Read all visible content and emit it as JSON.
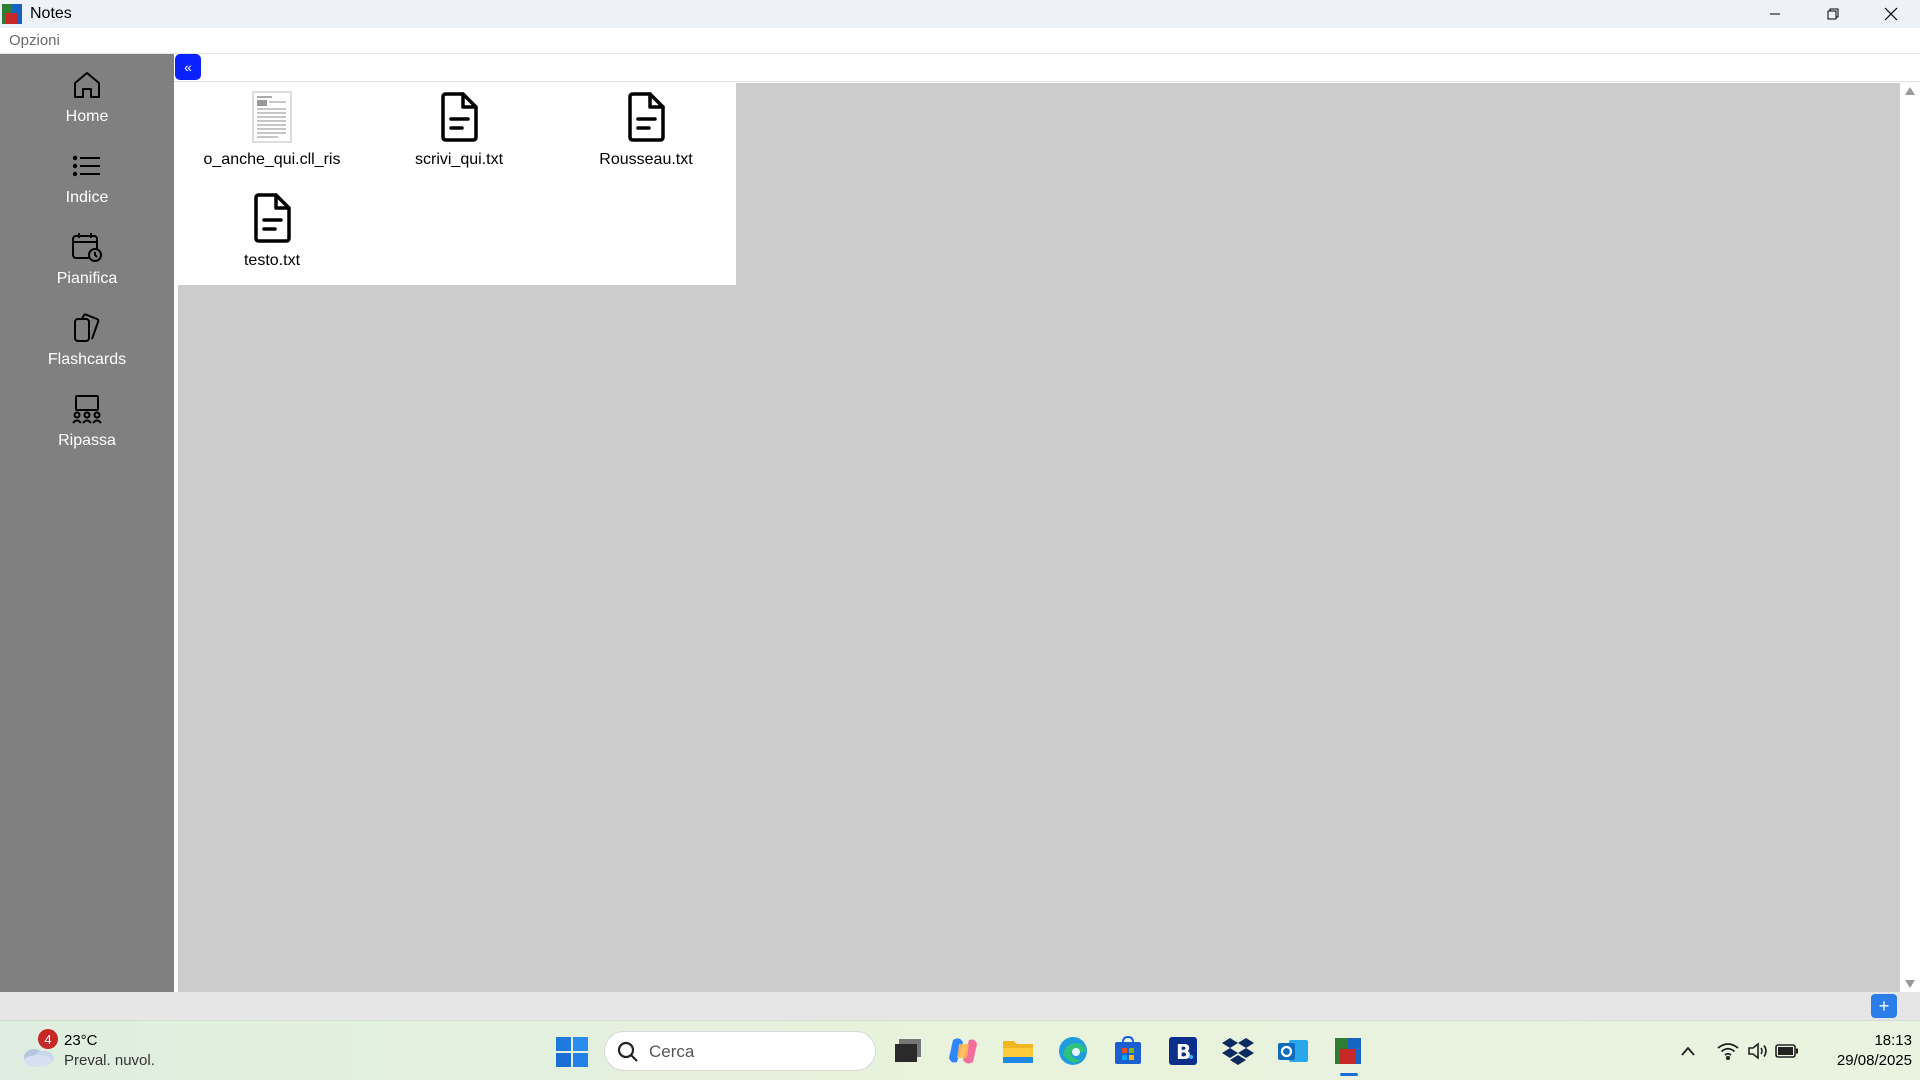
{
  "window": {
    "title": "Notes"
  },
  "menu": {
    "options_label": "Opzioni"
  },
  "sidebar": {
    "items": [
      {
        "label": "Home",
        "icon": "home-icon"
      },
      {
        "label": "Indice",
        "icon": "list-icon"
      },
      {
        "label": "Pianifica",
        "icon": "calendar-clock-icon"
      },
      {
        "label": "Flashcards",
        "icon": "flashcards-icon"
      },
      {
        "label": "Ripassa",
        "icon": "review-icon"
      }
    ]
  },
  "main": {
    "collapse_label": "«",
    "files": [
      {
        "name": "o_anche_qui.cll_ris",
        "icon": "document-thumbnail-icon"
      },
      {
        "name": "scrivi_qui.txt",
        "icon": "text-file-icon"
      },
      {
        "name": "Rousseau.txt",
        "icon": "text-file-icon"
      },
      {
        "name": "testo.txt",
        "icon": "text-file-icon"
      }
    ]
  },
  "statusbar": {
    "add_label": "+"
  },
  "taskbar": {
    "weather": {
      "badge": "4",
      "temp": "23°C",
      "desc": "Preval. nuvol."
    },
    "search_placeholder": "Cerca",
    "clock": {
      "time": "18:13",
      "date": "29/08/2025"
    }
  },
  "colors": {
    "sidebar_bg": "#808080",
    "canvas_bg": "#cccccc",
    "accent_blue": "#0a22ff",
    "plus_blue": "#2b7de9"
  }
}
